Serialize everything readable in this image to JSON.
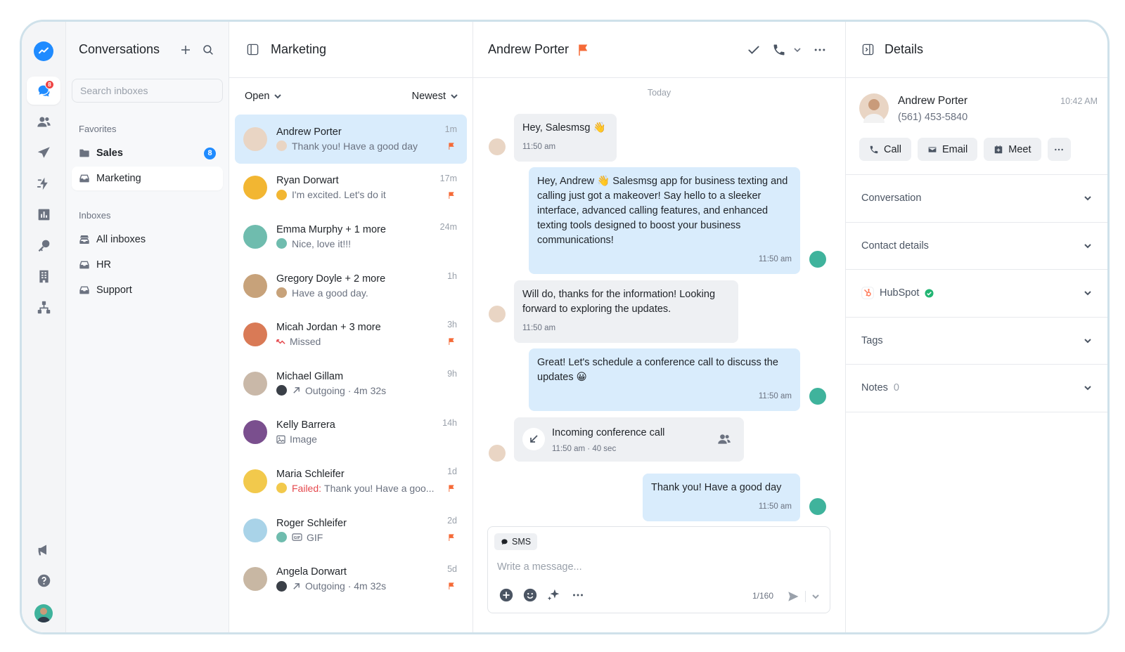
{
  "colors": {
    "accent": "#1f8bff",
    "flag": "#f56a37",
    "bubble_out": "#d9ecfc",
    "bubble_in": "#eef0f3",
    "danger": "#e5484d"
  },
  "rail": {
    "items": [
      {
        "icon": "conversations-icon",
        "badge": "8",
        "active": true
      },
      {
        "icon": "contacts-icon"
      },
      {
        "icon": "campaigns-icon"
      },
      {
        "icon": "automations-icon"
      },
      {
        "icon": "analytics-icon"
      },
      {
        "icon": "keyword-icon"
      },
      {
        "icon": "organization-icon"
      },
      {
        "icon": "integrations-icon"
      }
    ],
    "bottom": [
      {
        "icon": "announcements-icon"
      },
      {
        "icon": "help-icon"
      }
    ]
  },
  "sidebar": {
    "title": "Conversations",
    "search_placeholder": "Search inboxes",
    "favorites_label": "Favorites",
    "favorites": [
      {
        "label": "Sales",
        "count": "8",
        "icon": "folder-icon"
      },
      {
        "label": "Marketing",
        "icon": "inbox-icon"
      }
    ],
    "inboxes_label": "Inboxes",
    "inboxes": [
      {
        "label": "All inboxes",
        "icon": "all-inboxes-icon"
      },
      {
        "label": "HR",
        "icon": "inbox-icon"
      },
      {
        "label": "Support",
        "icon": "inbox-icon"
      }
    ]
  },
  "list": {
    "title": "Marketing",
    "filter_status": "Open",
    "filter_sort": "Newest",
    "conversations": [
      {
        "name": "Andrew Porter",
        "preview": "Thank you! Have a good day",
        "time": "1m",
        "flag": true,
        "avatar": "#e9d5c4"
      },
      {
        "name": "Ryan Dorwart",
        "preview": "I'm excited. Let's do it",
        "time": "17m",
        "flag": true,
        "avatar": "#f2b632"
      },
      {
        "name": "Emma Murphy + 1 more",
        "preview": "Nice, love it!!!",
        "time": "24m",
        "flag": false,
        "avatar": "#6fbcae"
      },
      {
        "name": "Gregory Doyle + 2 more",
        "preview": "Have a good day.",
        "time": "1h",
        "flag": false,
        "avatar": "#c7a27a"
      },
      {
        "name": "Micah Jordan + 3 more",
        "preview": "Missed",
        "time": "3h",
        "flag": true,
        "avatar": "#d97a56"
      },
      {
        "name": "Michael Gillam",
        "preview": "Outgoing · 4m 32s",
        "time": "9h",
        "flag": false,
        "avatar": "#c9b8a8"
      },
      {
        "name": "Kelly Barrera",
        "preview": "Image",
        "time": "14h",
        "flag": false,
        "avatar": "#7a4f8e"
      },
      {
        "name": "Maria Schleifer",
        "failed_label": "Failed:",
        "preview": "Thank you! Have a goo...",
        "time": "1d",
        "flag": true,
        "avatar": "#f2c94c"
      },
      {
        "name": "Roger Schleifer",
        "preview": "GIF",
        "time": "2d",
        "flag": true,
        "avatar": "#a9d3e8"
      },
      {
        "name": "Angela Dorwart",
        "preview": "Outgoing · 4m 32s",
        "time": "5d",
        "flag": true,
        "avatar": "#c8b7a3"
      }
    ]
  },
  "chat": {
    "contact_name": "Andrew Porter",
    "day_label": "Today",
    "messages": [
      {
        "dir": "in",
        "text": "Hey, Salesmsg 👋",
        "time": "11:50 am"
      },
      {
        "dir": "out",
        "text": "Hey, Andrew 👋 Salesmsg app for business texting and calling just got a makeover! Say hello to a sleeker interface, advanced calling features, and enhanced texting tools designed to boost your business communications!",
        "time": "11:50 am"
      },
      {
        "dir": "in",
        "text": "Will do, thanks for the information! Looking forward to exploring the updates.",
        "time": "11:50 am"
      },
      {
        "dir": "out",
        "text": "Great! Let's schedule a conference call to discuss the updates 😀",
        "time": "11:50 am"
      },
      {
        "dir": "in",
        "type": "call",
        "title": "Incoming conference call",
        "meta": "11:50 am · 40 sec"
      },
      {
        "dir": "out",
        "text": "Thank you! Have a good day",
        "time": "11:50 am"
      }
    ],
    "composer": {
      "channel": "SMS",
      "placeholder": "Write a message...",
      "counter": "1/160"
    }
  },
  "details": {
    "title": "Details",
    "contact": {
      "name": "Andrew Porter",
      "phone": "(561) 453-5840",
      "time": "10:42 AM"
    },
    "actions": [
      {
        "label": "Call"
      },
      {
        "label": "Email"
      },
      {
        "label": "Meet"
      }
    ],
    "sections": [
      {
        "label": "Conversation"
      },
      {
        "label": "Contact details"
      },
      {
        "label": "HubSpot",
        "integration": true
      },
      {
        "label": "Tags"
      },
      {
        "label": "Notes",
        "count": "0"
      }
    ]
  }
}
